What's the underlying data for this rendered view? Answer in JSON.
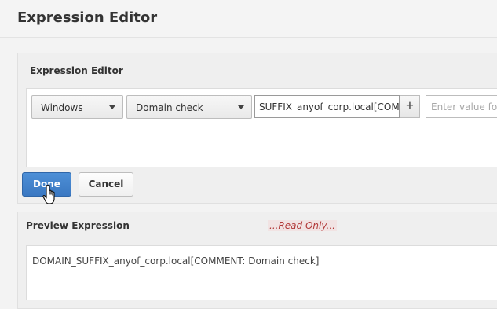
{
  "header": {
    "title": "Expression Editor"
  },
  "editor": {
    "label": "Expression Editor",
    "os_select": {
      "value": "Windows"
    },
    "check_select": {
      "value": "Domain check"
    },
    "value_field": {
      "value": "SUFFIX_anyof_corp.local[COM"
    },
    "plus_label": "+",
    "enter_field": {
      "placeholder": "Enter value for"
    }
  },
  "buttons": {
    "done": "Done",
    "cancel": "Cancel"
  },
  "preview": {
    "label": "Preview Expression",
    "readonly_badge": "...Read Only...",
    "text": "DOMAIN_SUFFIX_anyof_corp.local[COMMENT: Domain check]"
  },
  "colors": {
    "accent": "#3a78c2",
    "readonly": "#b23b3b"
  },
  "icons": {
    "cursor": "hand-pointer-icon",
    "dropdown": "chevron-down-icon"
  }
}
